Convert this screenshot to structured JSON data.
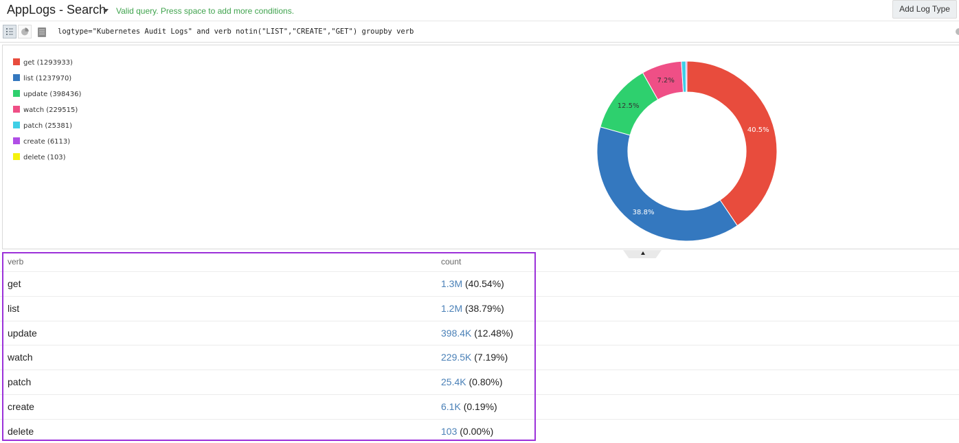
{
  "header": {
    "app_title": "AppLogs - Search",
    "status": "Valid query. Press space to add more conditions.",
    "add_log_type_label": "Add Log Type",
    "status_color": "#3fa34d"
  },
  "query": {
    "text": "logtype=\"Kubernetes Audit Logs\" and verb notin(\"LIST\",\"CREATE\",\"GET\") groupby verb",
    "view_buttons": [
      "list-view-icon",
      "pie-chart-icon",
      "document-icon"
    ]
  },
  "legend": [
    {
      "label": "get (1293933)",
      "color": "#e84c3d"
    },
    {
      "label": "list (1237970)",
      "color": "#3478bf"
    },
    {
      "label": "update (398436)",
      "color": "#2ed06e"
    },
    {
      "label": "watch (229515)",
      "color": "#ef4f86"
    },
    {
      "label": "patch (25381)",
      "color": "#3fcfe6"
    },
    {
      "label": "create (6113)",
      "color": "#b04ee6"
    },
    {
      "label": "delete (103)",
      "color": "#f5f20e"
    }
  ],
  "chart_data": {
    "type": "pie",
    "donut": true,
    "categories": [
      "get",
      "list",
      "update",
      "watch",
      "patch",
      "create",
      "delete"
    ],
    "values": [
      1293933,
      1237970,
      398436,
      229515,
      25381,
      6113,
      103
    ],
    "slice_labels": [
      "40.5%",
      "38.8%",
      "12.5%",
      "7.2%",
      "",
      "",
      ""
    ],
    "colors": [
      "#e84c3d",
      "#3478bf",
      "#2ed06e",
      "#ef4f86",
      "#3fcfe6",
      "#b04ee6",
      "#f5f20e"
    ],
    "legend_position": "left"
  },
  "table": {
    "headers": [
      "verb",
      "count"
    ],
    "rows": [
      {
        "verb": "get",
        "count": "1.3M",
        "pct": "(40.54%)"
      },
      {
        "verb": "list",
        "count": "1.2M",
        "pct": "(38.79%)"
      },
      {
        "verb": "update",
        "count": "398.4K",
        "pct": "(12.48%)"
      },
      {
        "verb": "watch",
        "count": "229.5K",
        "pct": "(7.19%)"
      },
      {
        "verb": "patch",
        "count": "25.4K",
        "pct": "(0.80%)"
      },
      {
        "verb": "create",
        "count": "6.1K",
        "pct": "(0.19%)"
      },
      {
        "verb": "delete",
        "count": "103",
        "pct": "(0.00%)"
      }
    ]
  },
  "colors": {
    "link": "#4a80b7",
    "highlight_border": "#9b30d9"
  }
}
